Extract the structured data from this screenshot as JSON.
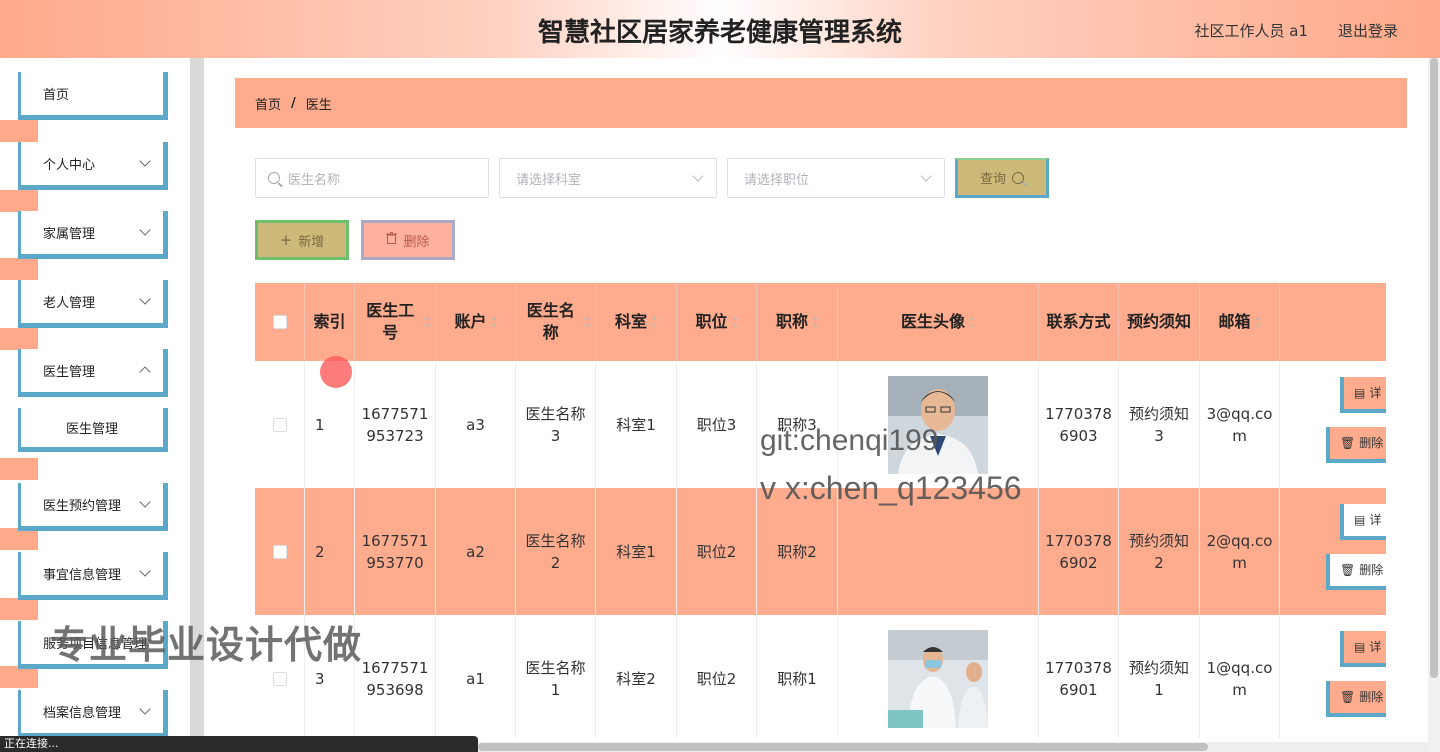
{
  "header": {
    "title": "智慧社区居家养老健康管理系统",
    "user": "社区工作人员 a1",
    "logout": "退出登录"
  },
  "sidebar": {
    "items": [
      {
        "label": "首页"
      },
      {
        "label": "个人中心"
      },
      {
        "label": "家属管理"
      },
      {
        "label": "老人管理"
      },
      {
        "label": "医生管理"
      },
      {
        "label": "医生管理"
      },
      {
        "label": "医生预约管理"
      },
      {
        "label": "事宜信息管理"
      },
      {
        "label": "服务项目信息管理"
      },
      {
        "label": "档案信息管理"
      }
    ]
  },
  "breadcrumb": {
    "home": "首页",
    "separator": "/",
    "current": "医生"
  },
  "search": {
    "name_placeholder": "医生名称",
    "dept_placeholder": "请选择科室",
    "position_placeholder": "请选择职位",
    "query_label": "查询"
  },
  "actions": {
    "add_label": "新增",
    "delete_label": "删除"
  },
  "table": {
    "headers": {
      "index": "索引",
      "doctor_no": "医生工号",
      "account": "账户",
      "doctor_name": "医生名称",
      "department": "科室",
      "position": "职位",
      "title": "职称",
      "avatar": "医生头像",
      "phone": "联系方式",
      "notice": "预约须知",
      "email": "邮箱"
    },
    "rows": [
      {
        "index": "1",
        "doctor_no": "1677571953723",
        "account": "a3",
        "doctor_name": "医生名称3",
        "department": "科室1",
        "position": "职位3",
        "title": "职称3",
        "phone": "17703786903",
        "notice": "预约须知3",
        "email": "3@qq.com",
        "has_avatar": true,
        "detail": "详",
        "del": "删除"
      },
      {
        "index": "2",
        "doctor_no": "1677571953770",
        "account": "a2",
        "doctor_name": "医生名称2",
        "department": "科室1",
        "position": "职位2",
        "title": "职称2",
        "phone": "17703786902",
        "notice": "预约须知2",
        "email": "2@qq.com",
        "has_avatar": false,
        "detail": "详",
        "del": "删除"
      },
      {
        "index": "3",
        "doctor_no": "1677571953698",
        "account": "a1",
        "doctor_name": "医生名称1",
        "department": "科室2",
        "position": "职位2",
        "title": "职称1",
        "phone": "17703786901",
        "notice": "预约须知1",
        "email": "1@qq.com",
        "has_avatar": true,
        "detail": "详",
        "del": "删除"
      }
    ]
  },
  "overlay": {
    "watermark_git": "git:chenqi199",
    "watermark_vx": "v x:chen_q123456",
    "watermark_ad": "专业毕业设计代做",
    "status_text": "正在连接..."
  },
  "colors": {
    "accent": "#ffab8e",
    "border_blue": "#5ba8c8",
    "query_btn": "#cdba7a"
  }
}
